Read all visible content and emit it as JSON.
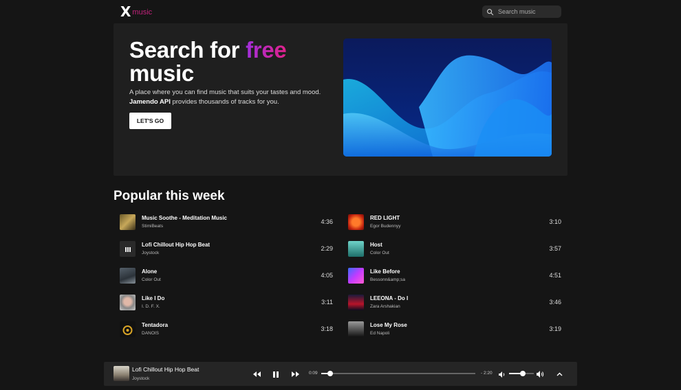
{
  "header": {
    "logo_mark": "X",
    "logo_text": "music",
    "search_placeholder": "Search music"
  },
  "hero": {
    "title_part1": "Search for ",
    "title_highlight": "free",
    "title_part2": "music",
    "desc_line1": "A place where you can find music that suits your tastes and mood.",
    "desc_bold": "Jamendo API",
    "desc_line2": " provides thousands of tracks for you.",
    "button_label": "LET'S GO"
  },
  "popular": {
    "title": "Popular this week",
    "left": [
      {
        "title": "Music Soothe - Meditation Music",
        "artist": "StimiBeats",
        "duration": "4:36"
      },
      {
        "title": "Lofi Chillout Hip Hop Beat",
        "artist": "Joystock",
        "duration": "2:29"
      },
      {
        "title": "Alone",
        "artist": "Color Out",
        "duration": "4:05"
      },
      {
        "title": "Like I Do",
        "artist": "I. D. F. X.",
        "duration": "3:11"
      },
      {
        "title": "Tentadora",
        "artist": "DANOIS",
        "duration": "3:18"
      }
    ],
    "right": [
      {
        "title": "RED LIGHT",
        "artist": "Egor Budennyy",
        "duration": "3:10"
      },
      {
        "title": "Host",
        "artist": "Color Out",
        "duration": "3:57"
      },
      {
        "title": "Like Before",
        "artist": "Bessonn&amp;sa",
        "duration": "4:51"
      },
      {
        "title": "LEEONA - Do I",
        "artist": "Zara Arshakian",
        "duration": "3:46"
      },
      {
        "title": "Lose My Rose",
        "artist": "Ed Napoli",
        "duration": "3:19"
      }
    ]
  },
  "player": {
    "title": "Lofi Chillout Hip Hop Beat",
    "artist": "Joystock",
    "current_time": "0:09",
    "remaining_time": "- 2:20",
    "progress_fraction": 0.06,
    "volume_fraction": 0.55
  },
  "icons": [
    "search-icon",
    "rewind-icon",
    "pause-icon",
    "fast-forward-icon",
    "volume-low-icon",
    "volume-high-icon",
    "chevron-up-icon"
  ],
  "colors": {
    "background": "#151515",
    "panel": "#1f1f1f",
    "accent_pink": "#e0218a",
    "accent_purple": "#a12fdc",
    "logo_accent": "#c2217b"
  }
}
